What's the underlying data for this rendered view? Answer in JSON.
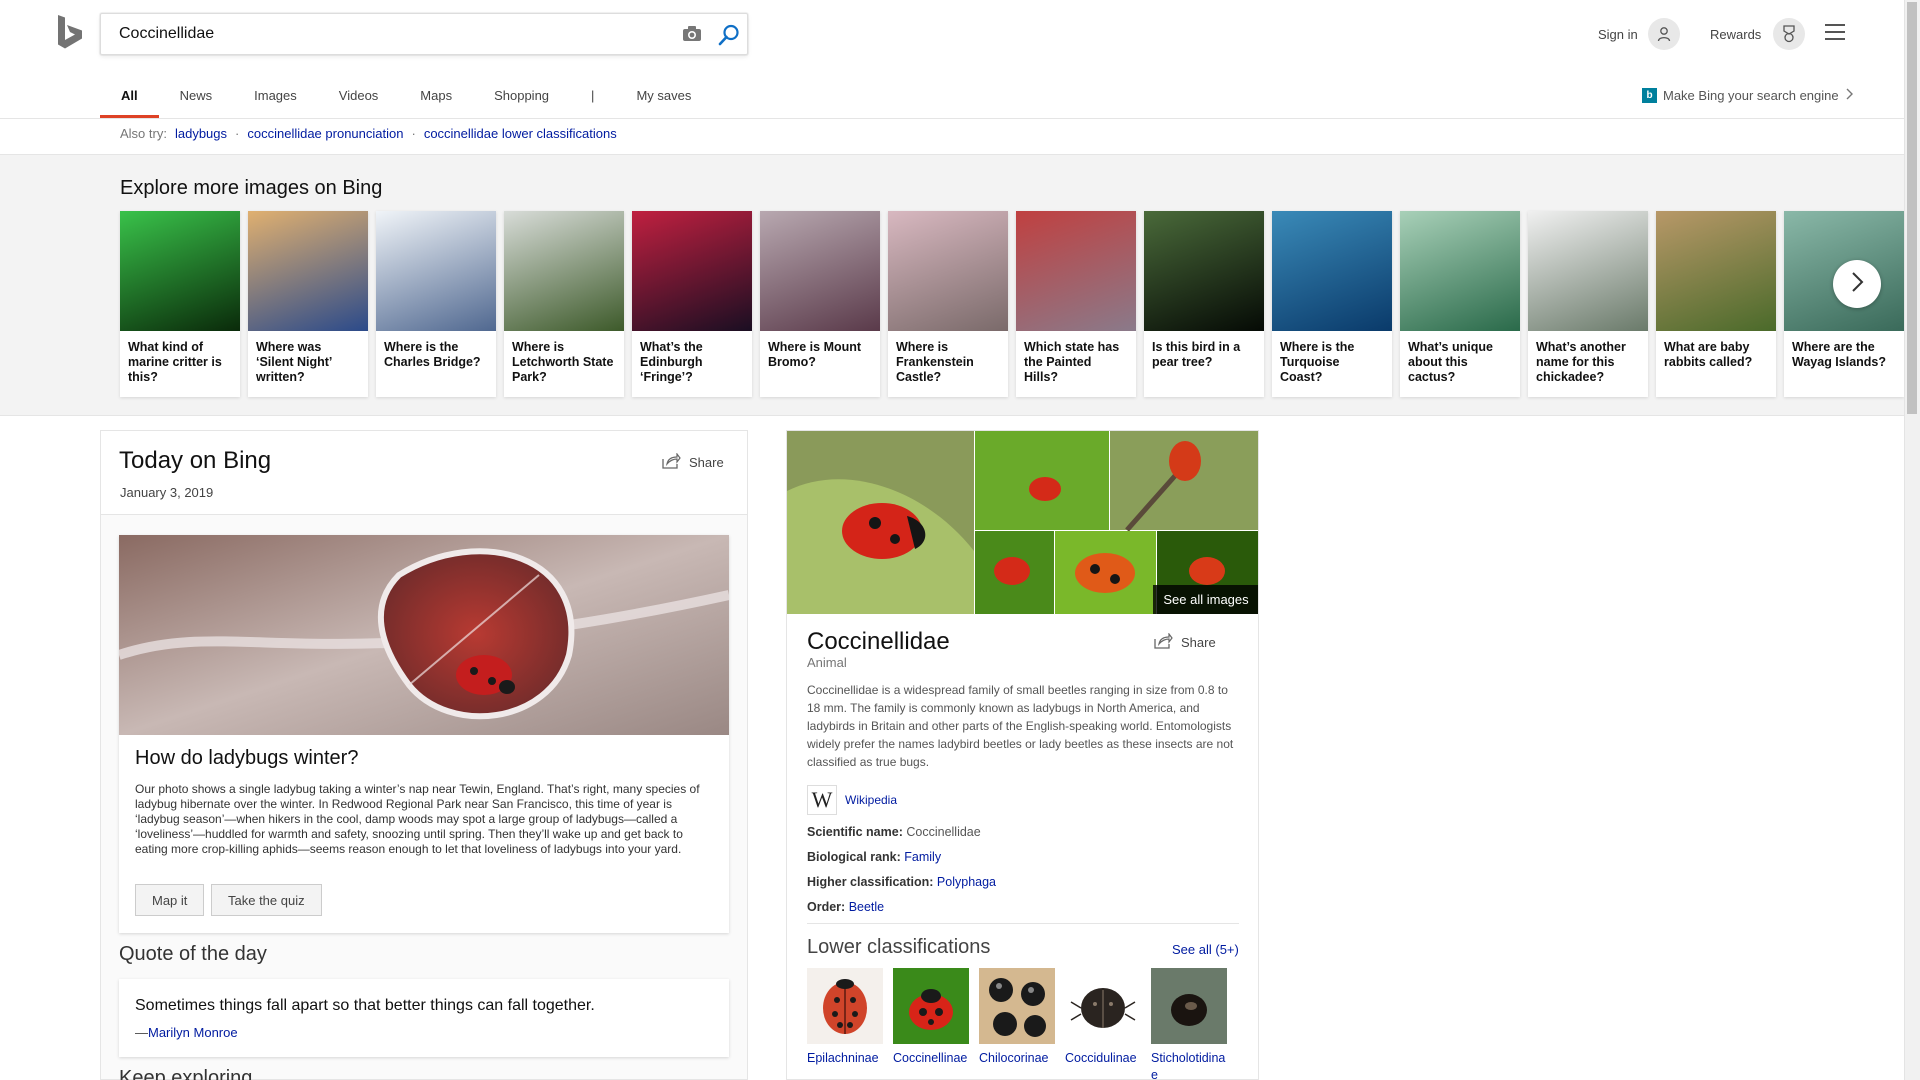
{
  "search": {
    "query": "Coccinellidae"
  },
  "header": {
    "signin_label": "Sign in",
    "rewards_label": "Rewards"
  },
  "tabs": [
    {
      "label": "All",
      "active": true
    },
    {
      "label": "News"
    },
    {
      "label": "Images"
    },
    {
      "label": "Videos"
    },
    {
      "label": "Maps"
    },
    {
      "label": "Shopping"
    },
    {
      "label": "|"
    },
    {
      "label": "My saves"
    }
  ],
  "make_bing": "Make Bing your search engine",
  "also_try": {
    "label": "Also try:",
    "links": [
      "ladybugs",
      "coccinellidae pronunciation",
      "coccinellidae lower classifications"
    ]
  },
  "explore": {
    "title": "Explore more images on Bing",
    "cards": [
      {
        "caption": "What kind of marine critter is this?",
        "colors": [
          "#0a2a0a",
          "#39c24a"
        ]
      },
      {
        "caption": "Where was ‘Silent Night’ written?",
        "colors": [
          "#2b4a8a",
          "#e0b070"
        ]
      },
      {
        "caption": "Where is the Charles Bridge?",
        "colors": [
          "#506890",
          "#f0f4f8"
        ]
      },
      {
        "caption": "Where is Letchworth State Park?",
        "colors": [
          "#3d5a2a",
          "#d8dcd8"
        ]
      },
      {
        "caption": "What’s the Edinburgh ‘Fringe’?",
        "colors": [
          "#1a0e22",
          "#c02040"
        ]
      },
      {
        "caption": "Where is Mount Bromo?",
        "colors": [
          "#5a3a4a",
          "#b8a8b0"
        ]
      },
      {
        "caption": "Where is Frankenstein Castle?",
        "colors": [
          "#7a6a6a",
          "#d8b8c0"
        ]
      },
      {
        "caption": "Which state has the Painted Hills?",
        "colors": [
          "#8a7a8a",
          "#c04040"
        ]
      },
      {
        "caption": "Is this bird in a pear tree?",
        "colors": [
          "#050a05",
          "#4a6a3a"
        ]
      },
      {
        "caption": "Where is the Turquoise Coast?",
        "colors": [
          "#0a3a6a",
          "#3a8ab8"
        ]
      },
      {
        "caption": "What’s unique about this cactus?",
        "colors": [
          "#2a6a4a",
          "#a8d0b8"
        ]
      },
      {
        "caption": "What’s another name for this chickadee?",
        "colors": [
          "#6a7a6a",
          "#f0f0f0"
        ]
      },
      {
        "caption": "What are baby rabbits called?",
        "colors": [
          "#4a6a2a",
          "#b89868"
        ]
      },
      {
        "caption": "Where are the Wayag Islands?",
        "colors": [
          "#3a6a5a",
          "#8ab8a8"
        ]
      }
    ]
  },
  "today": {
    "title": "Today on Bing",
    "date": "January 3, 2019",
    "share_label": "Share",
    "story_title": "How do ladybugs winter?",
    "story_body": "Our photo shows a single ladybug taking a winter’s nap near Tewin, England. That’s right, many species of ladybug hibernate over the winter. In Redwood Regional Park near San Francisco, this time of year is ‘ladybug season’—when hikers in the cool, damp woods may spot a large group of ladybugs—called a ‘loveliness’—huddled for warmth and safety, snoozing until spring. Then they’ll wake up and get back to eating more crop-killing aphids—seems reason enough to let that loveliness of ladybugs into your yard.",
    "btn_map": "Map it",
    "btn_quiz": "Take the quiz",
    "quote_heading": "Quote of the day",
    "quote_text": "Sometimes things fall apart so that better things can fall together.",
    "quote_dash": "—",
    "quote_author": "Marilyn Monroe",
    "keep_exploring": "Keep exploring"
  },
  "entity": {
    "see_all_images": "See all images",
    "title": "Coccinellidae",
    "subtitle": "Animal",
    "share_label": "Share",
    "description": "Coccinellidae is a widespread family of small beetles ranging in size from 0.8 to 18 mm. The family is commonly known as ladybugs in North America, and ladybirds in Britain and other parts of the English-speaking world. Entomologists widely prefer the names ladybird beetles or lady beetles as these insects are not classified as true bugs.",
    "wiki_label": "Wikipedia",
    "facts": {
      "scientific_label": "Scientific name:",
      "scientific_value": "Coccinellidae",
      "rank_label": "Biological rank:",
      "rank_value": "Family",
      "higher_label": "Higher classification:",
      "higher_value": "Polyphaga",
      "order_label": "Order:",
      "order_value": "Beetle"
    },
    "lower_title": "Lower classifications",
    "lower_see_all": "See all (5+)",
    "lower": [
      {
        "name": "Epilachninae"
      },
      {
        "name": "Coccinellinae"
      },
      {
        "name": "Chilocorinae"
      },
      {
        "name": "Coccidulinae"
      },
      {
        "name": "Sticholotidinae"
      }
    ]
  }
}
